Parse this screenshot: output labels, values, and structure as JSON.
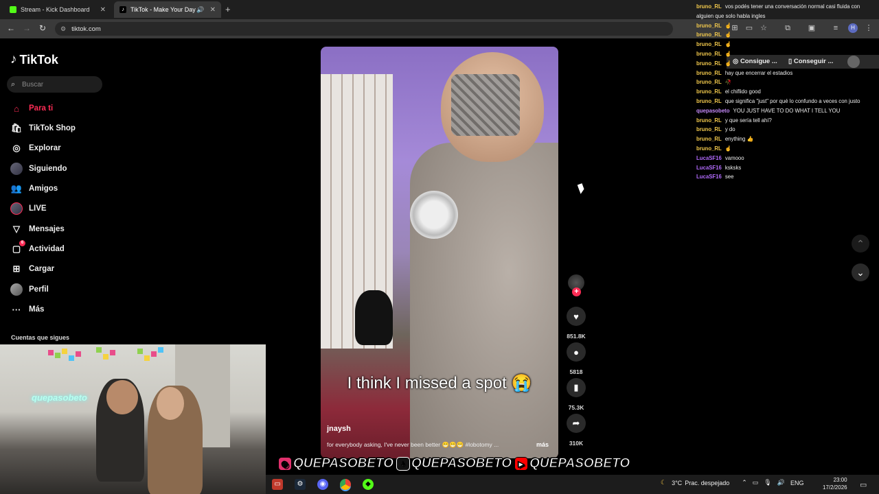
{
  "browser": {
    "tabs": [
      {
        "title": "Stream - Kick Dashboard",
        "favicon": "kick-icon",
        "color": "#53fc18"
      },
      {
        "title": "TikTok - Make Your Day",
        "favicon": "tiktok-icon",
        "active": true
      }
    ],
    "url": "tiktok.com",
    "bookmarks": [
      "Consigue ...",
      "Conseguir ..."
    ]
  },
  "sidebar": {
    "logo": "TikTok",
    "search_placeholder": "Buscar",
    "items": [
      {
        "label": "Para ti",
        "icon": "home-icon",
        "active": true
      },
      {
        "label": "TikTok Shop",
        "icon": "shop-icon"
      },
      {
        "label": "Explorar",
        "icon": "compass-icon"
      },
      {
        "label": "Siguiendo",
        "icon": "following-avatar-icon"
      },
      {
        "label": "Amigos",
        "icon": "friends-icon"
      },
      {
        "label": "LIVE",
        "icon": "live-icon"
      },
      {
        "label": "Mensajes",
        "icon": "messages-icon"
      },
      {
        "label": "Actividad",
        "icon": "activity-icon",
        "badge": "6"
      },
      {
        "label": "Cargar",
        "icon": "upload-icon"
      },
      {
        "label": "Perfil",
        "icon": "profile-icon"
      },
      {
        "label": "Más",
        "icon": "more-icon"
      }
    ],
    "following_header": "Cuentas que sigues"
  },
  "webcam": {
    "neon_sign": "quepasobeto"
  },
  "video": {
    "caption": "I think I missed a spot 😭",
    "author": "jnaysh",
    "description": "for everybody asking, I've never been better 😁😁😁 #lobotomy ...",
    "more_label": "más",
    "likes": "851.8K",
    "comments": "5818",
    "saves": "75.3K",
    "shares": "310K"
  },
  "chat": {
    "messages": [
      {
        "user": "bruno_RL",
        "text": "vos podés tener una conversación normal casi fluida con",
        "color": "#f2c94c"
      },
      {
        "user": "",
        "text": "alguien que solo habla ingles",
        "color": "#f2c94c"
      },
      {
        "user": "bruno_RL",
        "text": "☝",
        "color": "#f2c94c"
      },
      {
        "user": "bruno_RL",
        "text": "☝",
        "color": "#f2c94c"
      },
      {
        "user": "bruno_RL",
        "text": "☝",
        "color": "#f2c94c"
      },
      {
        "user": "bruno_RL",
        "text": "☝",
        "color": "#f2c94c"
      },
      {
        "user": "bruno_RL",
        "text": "☝",
        "color": "#f2c94c"
      },
      {
        "user": "bruno_RL",
        "text": "hay que encerrar el estadios",
        "color": "#f2c94c"
      },
      {
        "user": "bruno_RL",
        "text": "🥀",
        "color": "#f2c94c"
      },
      {
        "user": "bruno_RL",
        "text": "el chiflido good",
        "color": "#f2c94c"
      },
      {
        "user": "bruno_RL",
        "text": "que significa \"just\" por qué lo confundo a veces con justo",
        "color": "#f2c94c"
      },
      {
        "user": "quepasobeto",
        "text": "YOU JUST HAVE TO DO WHAT I TELL YOU",
        "color": "#c58af9"
      },
      {
        "user": "bruno_RL",
        "text": "y que sería tell ahí?",
        "color": "#f2c94c"
      },
      {
        "user": "bruno_RL",
        "text": "y do",
        "color": "#f2c94c"
      },
      {
        "user": "bruno_RL",
        "text": "enything 👍",
        "color": "#f2c94c"
      },
      {
        "user": "bruno_RL",
        "text": "☝",
        "color": "#f2c94c"
      },
      {
        "user": "LucaSF16",
        "text": "vamooo",
        "color": "#b36bff"
      },
      {
        "user": "LucaSF16",
        "text": "ksksks",
        "color": "#b36bff"
      },
      {
        "user": "LucaSF16",
        "text": "see",
        "color": "#b36bff"
      }
    ]
  },
  "banner": [
    {
      "platform": "instagram-icon",
      "handle": "QUEPASOBETO",
      "color": "#e1306c"
    },
    {
      "platform": "tiktok-icon",
      "handle": "QUEPASOBETO",
      "color": "#111111"
    },
    {
      "platform": "youtube-icon",
      "handle": "QUEPASOBETO",
      "color": "#ff0000"
    }
  ],
  "taskbar": {
    "weather": "3°C",
    "weather_desc": "Prac. despejado",
    "lang": "ENG",
    "time": "23:00",
    "date": "17/2/2026"
  }
}
